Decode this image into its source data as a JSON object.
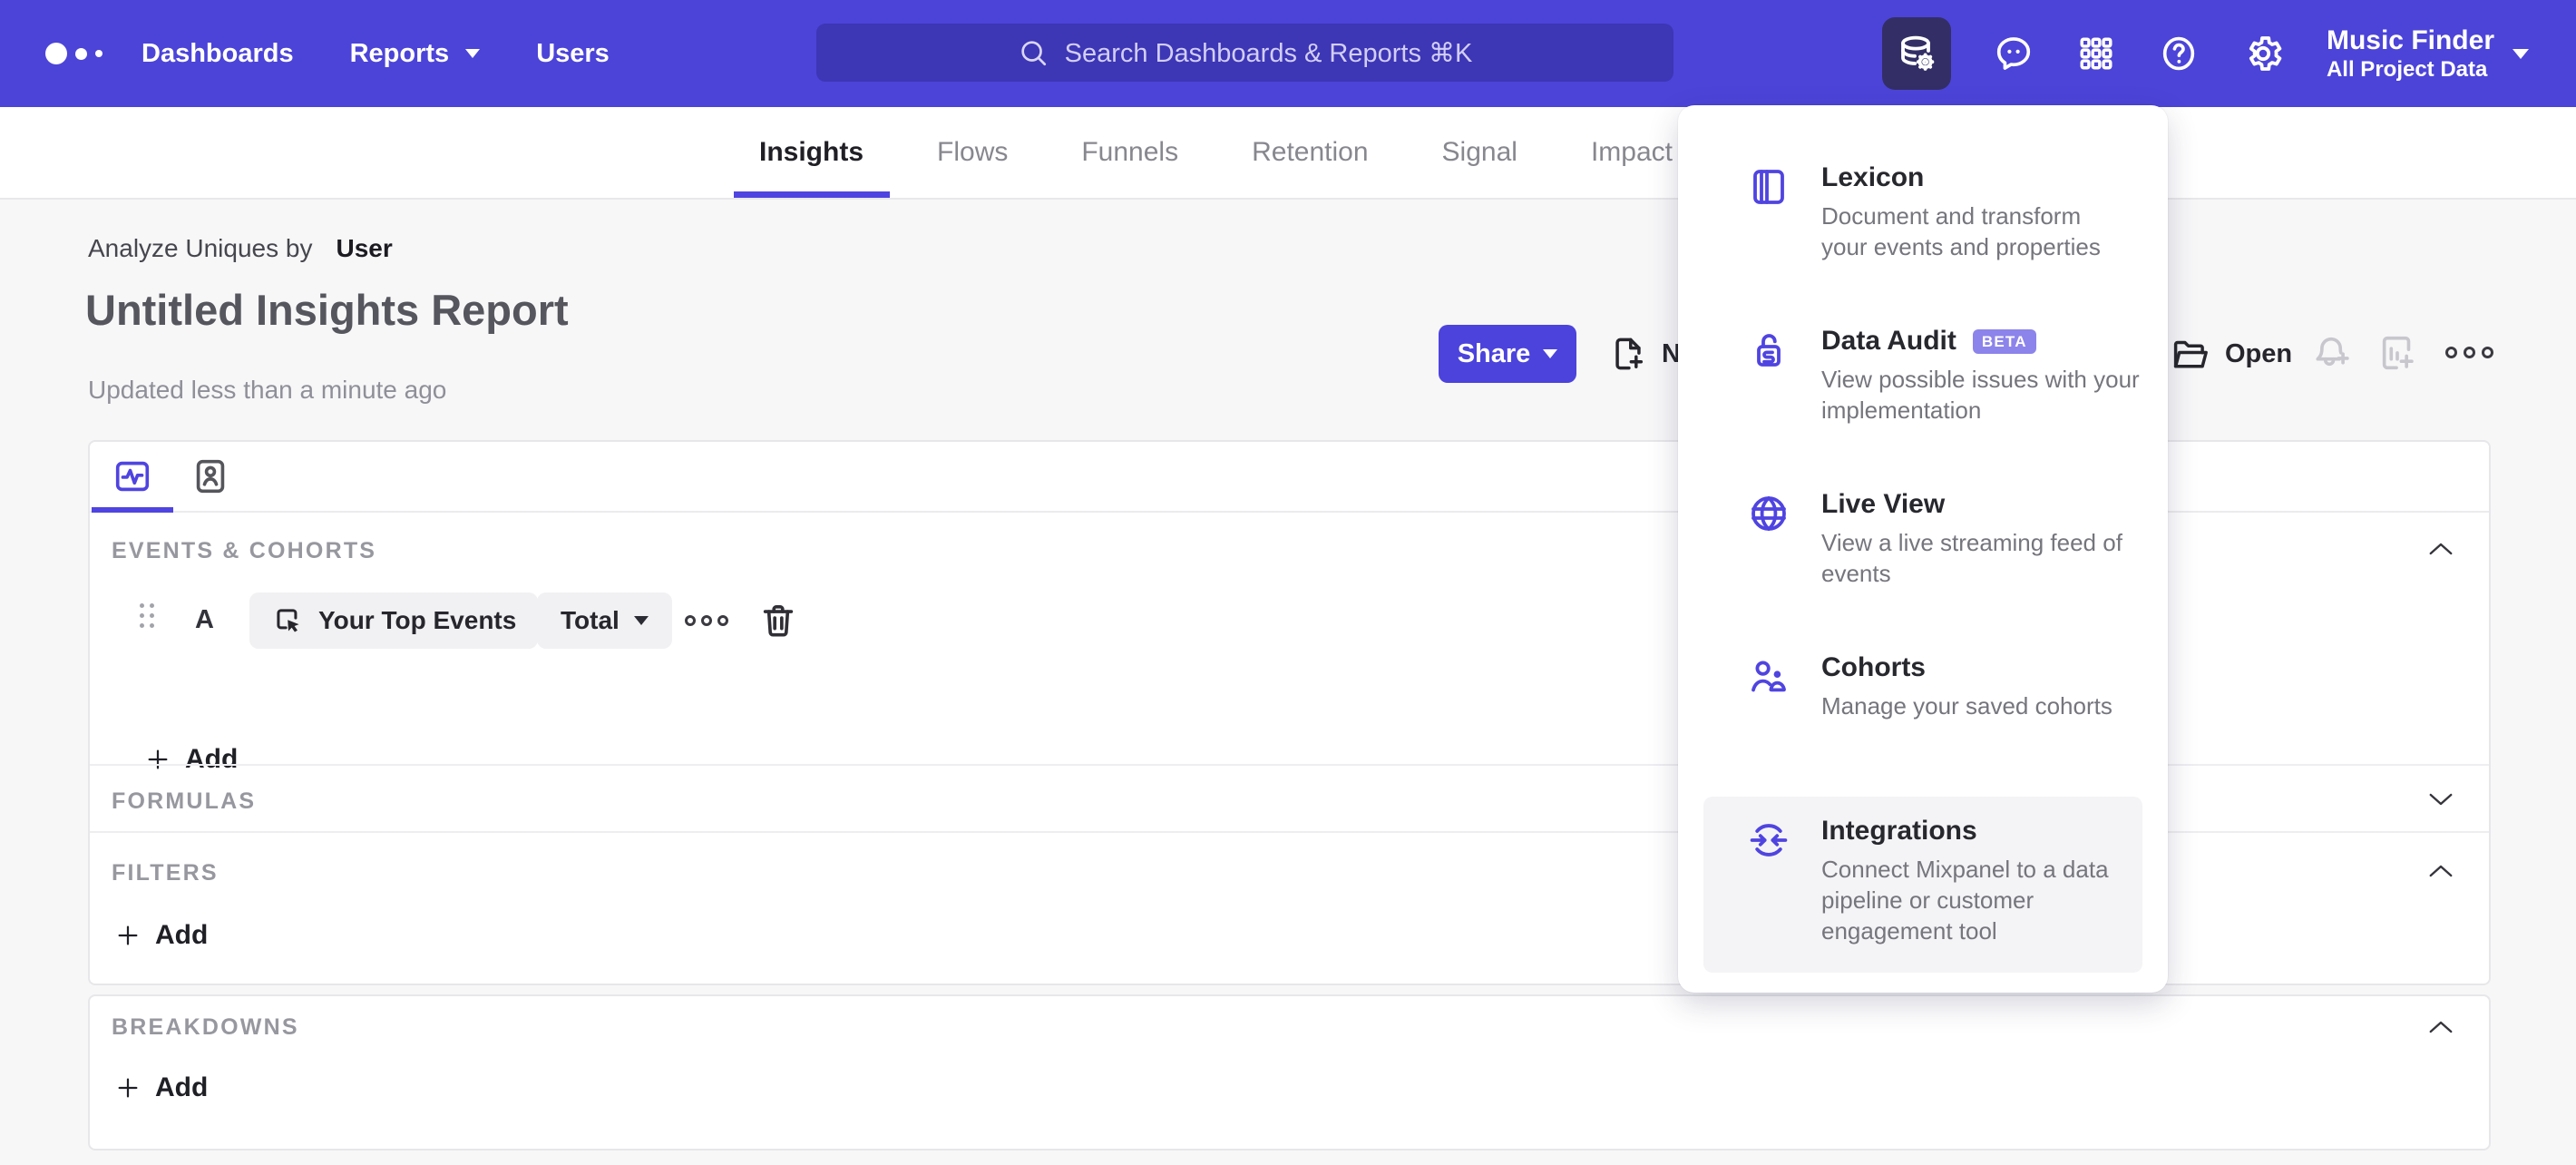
{
  "colors": {
    "topbar": "#4C44D8",
    "accent": "#4F44E0",
    "active_tile": "#332F66",
    "badge_bg": "#8C84EA",
    "page_bg": "#F7F7F8"
  },
  "topnav": {
    "dashboards": "Dashboards",
    "reports": "Reports",
    "users": "Users",
    "search_placeholder": "Search Dashboards & Reports ⌘K",
    "project_name": "Music Finder",
    "project_scope": "All Project Data"
  },
  "report_tabs": {
    "active": "Insights",
    "items": [
      {
        "label": "Insights"
      },
      {
        "label": "Flows"
      },
      {
        "label": "Funnels"
      },
      {
        "label": "Retention"
      },
      {
        "label": "Signal"
      },
      {
        "label": "Impact"
      }
    ]
  },
  "header": {
    "analyze_label": "Analyze Uniques by",
    "analyze_value": "User",
    "title": "Untitled Insights Report",
    "updated": "Updated less than a minute ago"
  },
  "toolbar": {
    "share_label": "Share",
    "new_label": "New",
    "open_label": "Open"
  },
  "tools_menu": {
    "items": [
      {
        "title": "Lexicon",
        "desc": "Document and transform\nyour events and properties"
      },
      {
        "title": "Data Audit",
        "badge": "BETA",
        "desc": "View possible issues with your\nimplementation"
      },
      {
        "title": "Live View",
        "desc": "View a live streaming feed of\nevents"
      },
      {
        "title": "Cohorts",
        "desc": "Manage your saved cohorts"
      },
      {
        "title": "Integrations",
        "desc": "Connect Mixpanel to a data\npipeline or customer\nengagement tool"
      }
    ]
  },
  "query_builder": {
    "events": {
      "heading": "EVENTS & COHORTS",
      "row_label": "A",
      "event_name": "Your Top Events",
      "aggregation": "Total",
      "add_label": "Add"
    },
    "formulas": {
      "heading": "FORMULAS"
    },
    "filters": {
      "heading": "FILTERS",
      "add_label": "Add"
    },
    "breakdowns": {
      "heading": "BREAKDOWNS",
      "add_label": "Add"
    }
  }
}
